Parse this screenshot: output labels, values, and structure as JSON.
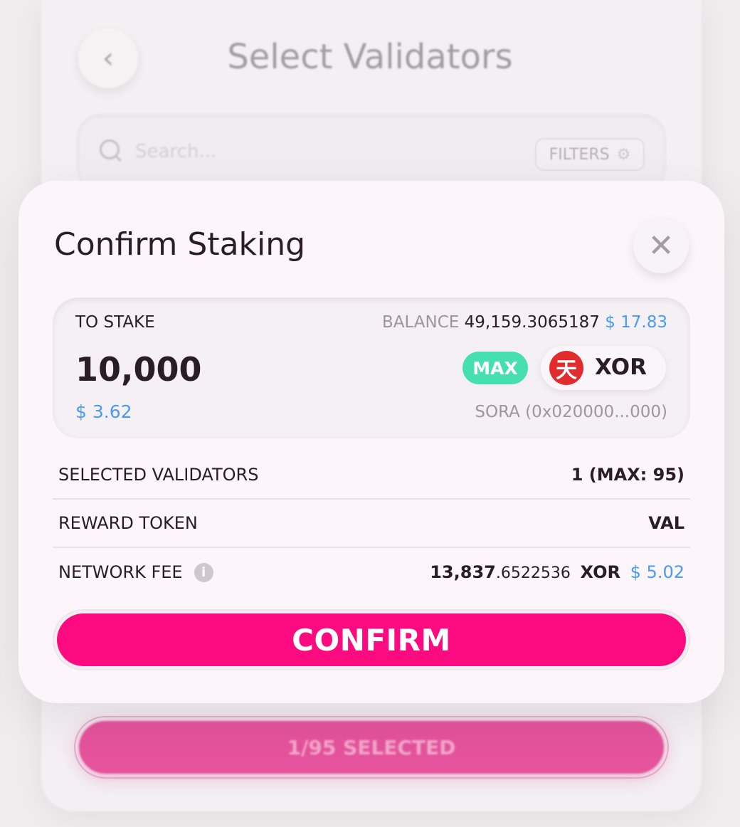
{
  "background": {
    "title": "Select Validators",
    "back_icon": "chevron-left-icon",
    "search_placeholder": "Search...",
    "filters_label": "FILTERS",
    "selected_button": "1/95 SELECTED"
  },
  "modal": {
    "title": "Confirm Staking",
    "to_stake": {
      "label": "TO STAKE",
      "balance_label": "BALANCE",
      "balance_value": "49,159.3065187",
      "balance_usd": "$ 17.83",
      "amount": "10,000",
      "amount_usd": "$ 3.62",
      "max_label": "MAX",
      "token_symbol": "XOR",
      "token_logo_glyph": "天",
      "network": "SORA (0x020000...000)"
    },
    "rows": {
      "validators_label": "SELECTED VALIDATORS",
      "validators_value": "1 (MAX: 95)",
      "reward_label": "REWARD TOKEN",
      "reward_value": "VAL",
      "fee_label": "NETWORK FEE",
      "fee_int": "13,837",
      "fee_dec": ".6522536",
      "fee_symbol": "XOR",
      "fee_usd": "$ 5.02"
    },
    "confirm_label": "CONFIRM"
  },
  "colors": {
    "accent": "#fc0a80",
    "max": "#46dfb0",
    "usd": "#4a9bf4",
    "text": "#2b1d25"
  }
}
